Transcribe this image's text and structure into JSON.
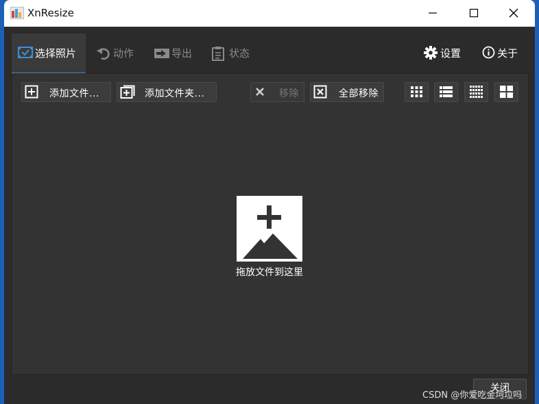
{
  "window": {
    "title": "XnResize"
  },
  "tabs": [
    {
      "label": "选择照片",
      "icon": "select-photos-icon",
      "active": true
    },
    {
      "label": "动作",
      "icon": "undo-arrow-icon",
      "active": false
    },
    {
      "label": "导出",
      "icon": "export-icon",
      "active": false
    },
    {
      "label": "状态",
      "icon": "clipboard-icon",
      "active": false
    }
  ],
  "header_right": {
    "settings_label": "设置",
    "about_label": "关于"
  },
  "toolbar": {
    "add_files_label": "添加文件...",
    "add_folder_label": "添加文件夹...",
    "remove_label": "移除",
    "remove_all_label": "全部移除",
    "view_modes": [
      "grid-small",
      "list",
      "grid-dense",
      "grid-large"
    ]
  },
  "dropzone": {
    "label": "拖放文件到这里",
    "icon": "add-image-icon"
  },
  "footer": {
    "close_label": "关闭"
  },
  "watermark": {
    "text": "CSDN @你爱吃金坷垃吗"
  },
  "colors": {
    "accent": "#3d8fd6",
    "background": "#2b2b2b",
    "panel": "#333333"
  }
}
